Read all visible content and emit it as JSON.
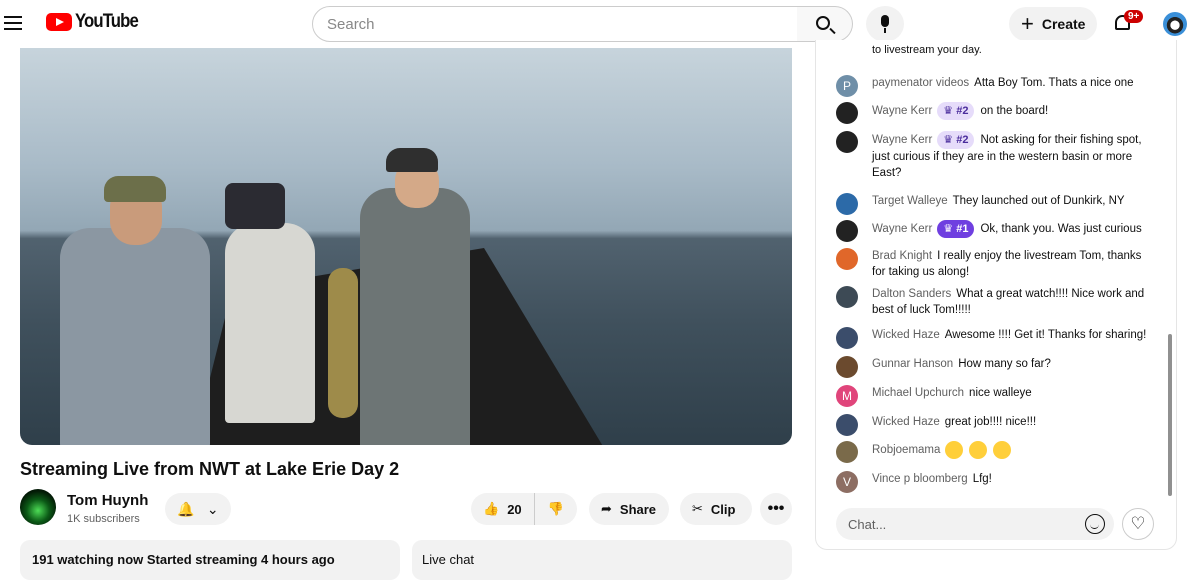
{
  "header": {
    "logo_text": "YouTube",
    "search_placeholder": "Search",
    "create_label": "Create",
    "notification_count": "9+"
  },
  "video": {
    "title": "Streaming Live from NWT at Lake Erie Day 2",
    "channel_name": "Tom Huynh",
    "subscribers": "1K subscribers",
    "like_count": "20",
    "share_label": "Share",
    "clip_label": "Clip",
    "more_label": "•••"
  },
  "info": {
    "watching_text": "191 watching now  Started streaming 4 hours ago"
  },
  "live_chat_label": "Live chat",
  "chat": {
    "cut_text": "to livestream your day.",
    "messages": [
      {
        "author": "paymenator videos",
        "text": "Atta Boy Tom. Thats a nice one",
        "avatar_letter": "P",
        "avatar_color": "#6f8fa8"
      },
      {
        "author": "Wayne Kerr",
        "badge": "#2",
        "text": "on the board!",
        "avatar_color": "#222222"
      },
      {
        "author": "Wayne Kerr",
        "badge": "#2",
        "text": "Not asking for their fishing spot, just curious if they are in the western basin or more East?",
        "avatar_color": "#222222"
      },
      {
        "author": "Target Walleye",
        "text": "They launched out of Dunkirk, NY",
        "avatar_color": "#2c6aa8"
      },
      {
        "author": "Wayne Kerr",
        "badge": "#1",
        "text": "Ok, thank you. Was just curious",
        "avatar_color": "#222222"
      },
      {
        "author": "Brad Knight",
        "text": "I really enjoy the livestream Tom, thanks for taking us along!",
        "avatar_color": "#e0672a"
      },
      {
        "author": "Dalton Sanders",
        "text": "What a great watch!!!! Nice work and best of luck Tom!!!!!",
        "avatar_color": "#3d4a55"
      },
      {
        "author": "Wicked Haze",
        "text": "Awesome !!!! Get it! Thanks for sharing!",
        "avatar_color": "#3b4d6b"
      },
      {
        "author": "Gunnar Hanson",
        "text": "How many so far?",
        "avatar_color": "#6b4a2e"
      },
      {
        "author": "Michael Upchurch",
        "text": "nice walleye",
        "avatar_letter": "M",
        "avatar_color": "#e0457b"
      },
      {
        "author": "Wicked Haze",
        "text": "great job!!!! nice!!!",
        "avatar_color": "#3b4d6b"
      },
      {
        "author": "Robjoemama",
        "text": "",
        "avatar_color": "#7a6a4a"
      },
      {
        "author": "Vince p bloomberg",
        "text": "Lfg!",
        "avatar_letter": "V",
        "avatar_color": "#8d6e63"
      }
    ],
    "input_placeholder": "Chat..."
  }
}
